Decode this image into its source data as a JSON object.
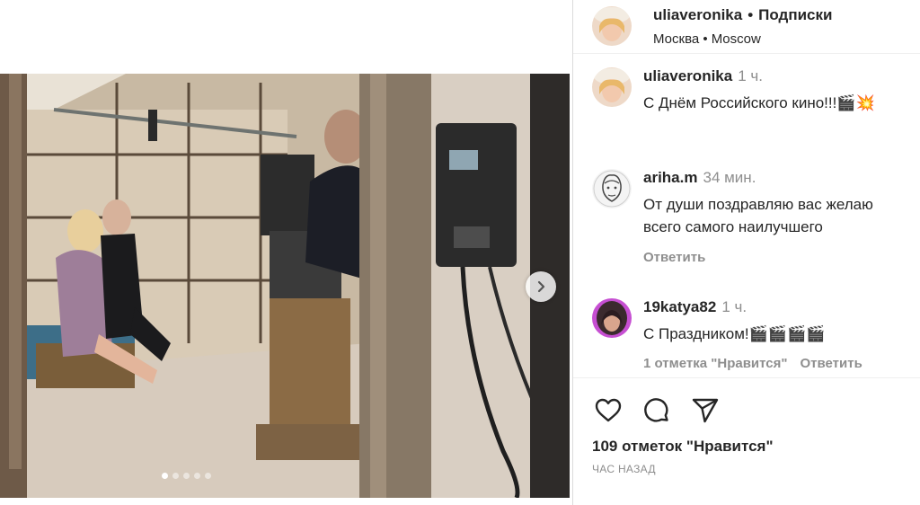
{
  "post": {
    "username": "uliaveronika",
    "separator": "•",
    "follow_label": "Подписки",
    "location": "Москва • Moscow",
    "carousel": {
      "slide_count": 5,
      "active_index": 0
    }
  },
  "caption": {
    "username": "uliaveronika",
    "time": "1 ч.",
    "text": "С Днём Российского кино!!!🎬💥"
  },
  "comments": [
    {
      "username": "ariha.m",
      "time": "34 мин.",
      "lines": [
        "От души поздравляю вас желаю",
        "всего самого наилучшего"
      ],
      "reply_label": "Ответить"
    },
    {
      "username": "19katya82",
      "time": "1 ч.",
      "lines": [
        "С Праздником!🎬🎬🎬🎬"
      ],
      "likes_label": "1 отметка \"Нравится\"",
      "reply_label": "Ответить"
    }
  ],
  "footer": {
    "icons": [
      "heart-icon",
      "comment-icon",
      "share-icon"
    ],
    "likes": "109 отметок \"Нравится\"",
    "posted": "ЧАС НАЗАД"
  }
}
